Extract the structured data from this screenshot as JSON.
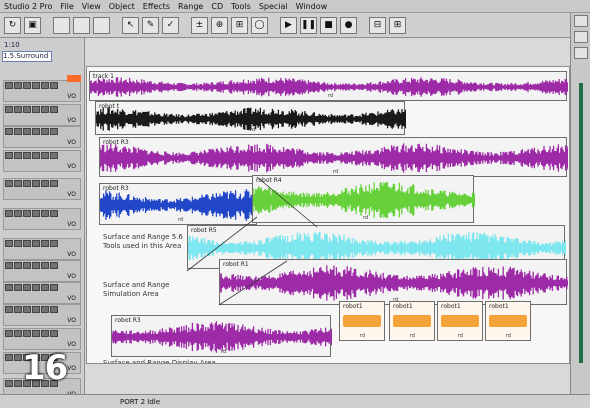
{
  "title_bar": "Studio 2 Pro",
  "menu": [
    "File",
    "View",
    "Object",
    "Effects",
    "Range",
    "CD",
    "Tools",
    "Special",
    "Window"
  ],
  "toolbar": {
    "buttons": [
      "open",
      "save",
      "arrow",
      "pencil",
      "move",
      "zoom",
      "grid",
      "play",
      "stop",
      "record"
    ]
  },
  "left_panel": {
    "header": "1:10",
    "session_label": "1.5.Surround",
    "track_level_label": "VO"
  },
  "clips": [
    {
      "label": "track 1",
      "color": "#9d2aa7"
    },
    {
      "label": "robot t",
      "color": "#1a1a1a"
    },
    {
      "label": "robot R3",
      "color": "#9d2aa7"
    },
    {
      "label": "robot R3",
      "color": "#2147c8"
    },
    {
      "label": "robot R4",
      "color": "#67d13b"
    },
    {
      "label": "robot R5",
      "color": "#7de6ee"
    },
    {
      "label": "robot R1",
      "color": "#9d2aa7"
    },
    {
      "label": "robot R3",
      "color": "#9d2aa7"
    }
  ],
  "notes": [
    {
      "text": "Surface and Range 5.6 Tools used in this Area"
    },
    {
      "text": "Surface and Range Simulation Area"
    },
    {
      "text": "Surface and Range Display Area"
    }
  ],
  "orange_clips": [
    {
      "label": "robot1"
    },
    {
      "label": "robot1"
    },
    {
      "label": "robot1"
    },
    {
      "label": "robot1"
    }
  ],
  "footer_marker": "rd",
  "page_number": "16",
  "statusbar": {
    "text": "PORT 2 Idle"
  }
}
